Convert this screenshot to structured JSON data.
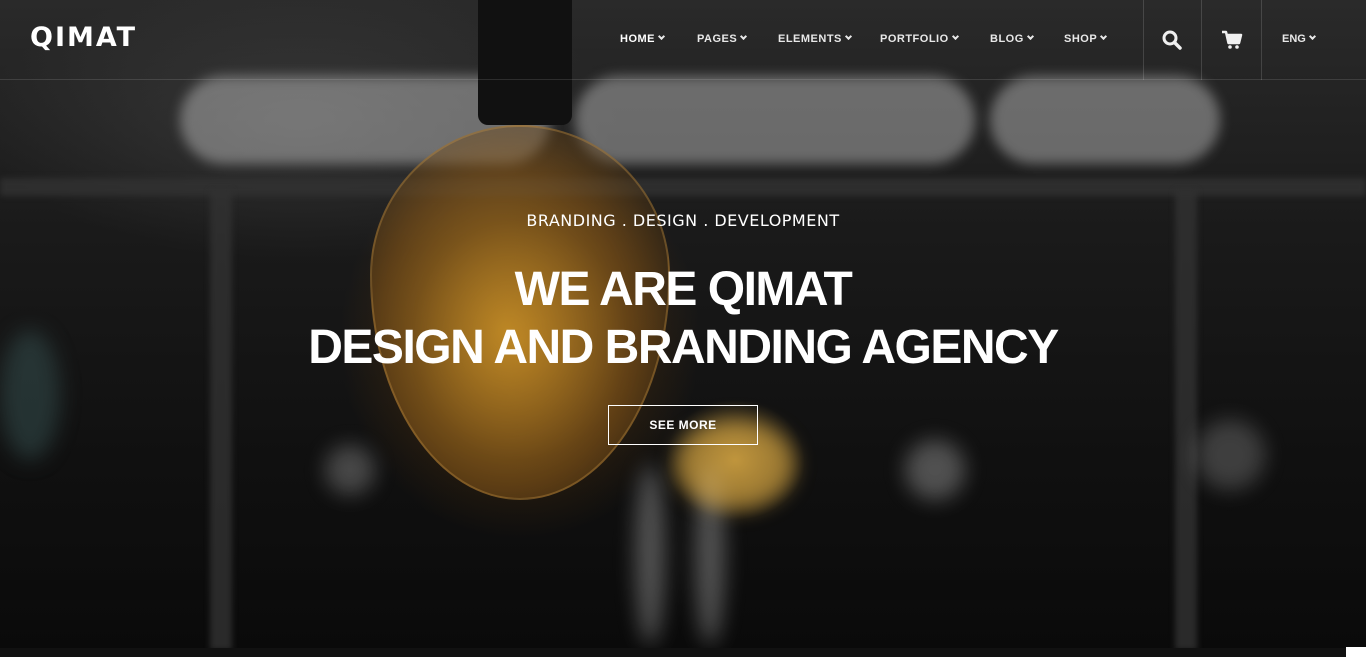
{
  "brand": {
    "logo": "QIMAT"
  },
  "nav": {
    "items": [
      {
        "label": "HOME",
        "active": true
      },
      {
        "label": "PAGES",
        "active": false
      },
      {
        "label": "ELEMENTS",
        "active": false
      },
      {
        "label": "PORTFOLIO",
        "active": false
      },
      {
        "label": "BLOG",
        "active": false
      },
      {
        "label": "SHOP",
        "active": false
      }
    ],
    "search_icon": "search-icon",
    "cart_icon": "cart-icon",
    "language": "ENG"
  },
  "hero": {
    "subtitle": "BRANDING . DESIGN . DEVELOPMENT",
    "title_line1": "WE ARE QIMAT",
    "title_line2": "DESIGN AND BRANDING AGENCY",
    "cta_label": "SEE MORE"
  },
  "colors": {
    "text": "#ffffff",
    "overlay": "#101010",
    "bulb_glow": "#e6a028"
  }
}
